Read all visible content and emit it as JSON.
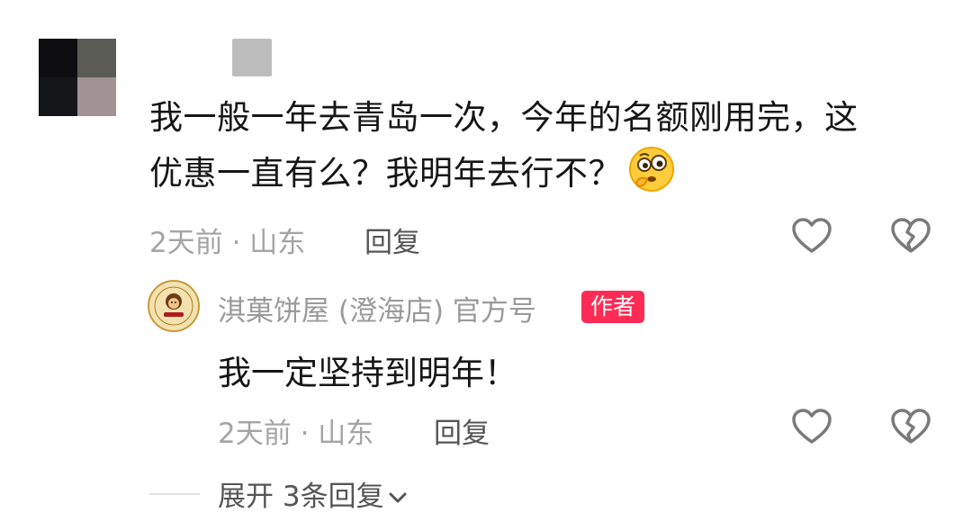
{
  "comment": {
    "text_line1": "我一般一年去青岛一次，今年的名额刚用完，这",
    "text_line2": "优惠一直有么？我明年去行不？",
    "emoji_icon": "thinking-face-emoji",
    "time_location": "2天前 · 山东",
    "reply_label": "回复",
    "avatar_colors": [
      "#0e0e10",
      "#5a5b55",
      "#14161a",
      "#a19394"
    ]
  },
  "reply": {
    "author_name": "淇菓饼屋 (澄海店) 官方号",
    "author_badge": "作者",
    "text": "我一定坚持到明年！",
    "time_location": "2天前 · 山东",
    "reply_label": "回复",
    "avatar_icon": "bakery-logo-icon",
    "badge_color": "#fe2c55"
  },
  "expand_replies": {
    "label": "展开 3条回复",
    "icon": "chevron-down-icon"
  }
}
